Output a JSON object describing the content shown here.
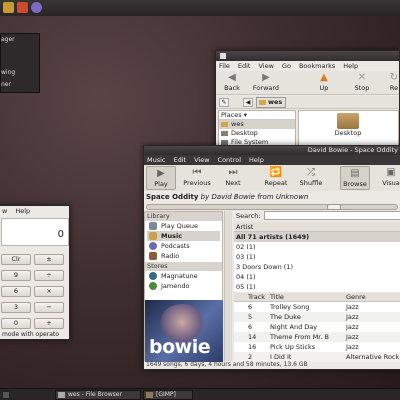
{
  "top_panel": {
    "colors": [
      "#c99a2e",
      "#7b6ac2"
    ]
  },
  "sys_menu": {
    "items": [
      "ager",
      "wing",
      "ner"
    ]
  },
  "file_browser": {
    "title": "",
    "menu": [
      "File",
      "Edit",
      "View",
      "Go",
      "Bookmarks",
      "Help"
    ],
    "toolbar": {
      "back": "Back",
      "forward": "Forward",
      "up": "Up",
      "stop": "Stop",
      "reload": "Re"
    },
    "location": "wes",
    "places_label": "Places",
    "places": [
      "wes",
      "Desktop",
      "File System"
    ],
    "main_items": [
      "Desktop"
    ]
  },
  "calculator": {
    "menu": [
      "w",
      "Help"
    ],
    "display": "0",
    "buttons": [
      "Clr",
      "±",
      "9",
      "÷",
      "6",
      "×",
      "3",
      "−",
      "0",
      "+"
    ],
    "status": "mode with operato"
  },
  "music": {
    "title": "David Bowie - Space Oddity",
    "menu": [
      "Music",
      "Edit",
      "View",
      "Control",
      "Help"
    ],
    "toolbar": {
      "play": "Play",
      "previous": "Previous",
      "next": "Next",
      "repeat": "Repeat",
      "shuffle": "Shuffle",
      "browse": "Browse",
      "visualize": "Visua"
    },
    "now_playing": {
      "song": "Space Oddity",
      "by": "by",
      "artist": "David Bowie",
      "from": "from",
      "album": "Unknown"
    },
    "library_label": "Library",
    "library": [
      "Play Queue",
      "Music",
      "Podcasts",
      "Radio"
    ],
    "stores_label": "Stores",
    "stores": [
      "Magnatune",
      "Jamendo"
    ],
    "art_text": "bowie",
    "search_label": "Search:",
    "artist_header": "Artist",
    "artists": [
      "All 71 artists (1649)",
      "02 (1)",
      "03 (1)",
      "3 Doors Down (1)",
      "04 (1)",
      "05 (1)"
    ],
    "track_headers": [
      "Track",
      "Title",
      "Genre"
    ],
    "tracks": [
      {
        "num": "6",
        "title": "Trolley Song",
        "genre": "Jazz"
      },
      {
        "num": "5",
        "title": "The Duke",
        "genre": "Jazz"
      },
      {
        "num": "6",
        "title": "Night And Day",
        "genre": "Jazz"
      },
      {
        "num": "14",
        "title": "Theme From Mr. B",
        "genre": "Jazz"
      },
      {
        "num": "16",
        "title": "Pick Up Sticks",
        "genre": "Jazz"
      },
      {
        "num": "2",
        "title": "I Did It",
        "genre": "Alternative Rock"
      }
    ],
    "status": "1649 songs, 6 days, 4 hours and 58 minutes, 13.6 GB"
  },
  "bottom_panel": {
    "tasks": [
      "wes - File Browser",
      "[GIMP]"
    ]
  }
}
